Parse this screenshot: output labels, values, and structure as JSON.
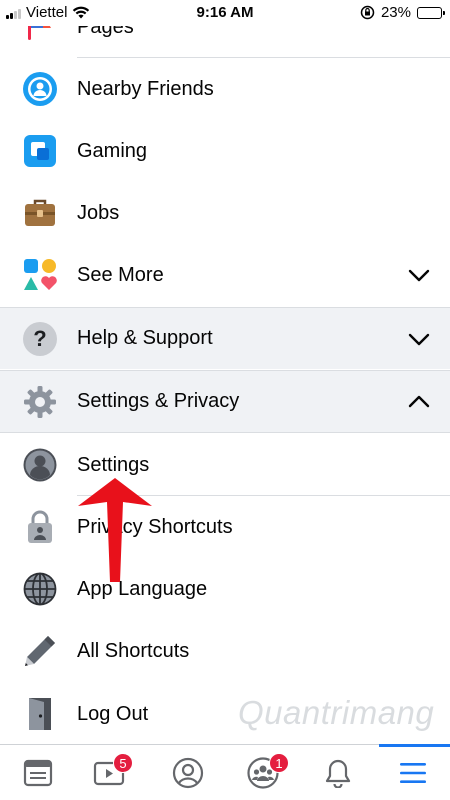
{
  "status_bar": {
    "carrier": "Viettel",
    "time": "9:16 AM",
    "battery_percent": "23%",
    "battery_level": 0.23
  },
  "menu": {
    "items": [
      {
        "label": "Pages",
        "icon": "pages-flag-icon"
      },
      {
        "label": "Nearby Friends",
        "icon": "nearby-friends-icon"
      },
      {
        "label": "Gaming",
        "icon": "gaming-icon"
      },
      {
        "label": "Jobs",
        "icon": "briefcase-icon"
      },
      {
        "label": "See More",
        "icon": "see-more-shapes-icon"
      }
    ],
    "help": {
      "label": "Help & Support",
      "icon": "question-icon"
    },
    "settings_privacy": {
      "label": "Settings & Privacy",
      "icon": "gear-icon"
    },
    "sub_items": [
      {
        "label": "Settings",
        "icon": "profile-icon"
      },
      {
        "label": "Privacy Shortcuts",
        "icon": "lock-icon"
      },
      {
        "label": "App Language",
        "icon": "globe-icon"
      },
      {
        "label": "All Shortcuts",
        "icon": "pencil-icon"
      },
      {
        "label": "Log Out",
        "icon": "door-icon"
      }
    ]
  },
  "tab_bar": {
    "tabs": [
      {
        "name": "news-feed",
        "icon": "news-feed-icon"
      },
      {
        "name": "watch",
        "icon": "watch-icon",
        "badge": "5"
      },
      {
        "name": "profile",
        "icon": "profile-icon"
      },
      {
        "name": "groups",
        "icon": "groups-icon",
        "badge": "1"
      },
      {
        "name": "notifications",
        "icon": "bell-icon"
      },
      {
        "name": "menu",
        "icon": "hamburger-icon",
        "active": true
      }
    ]
  },
  "watermark": "Quantrimang",
  "colors": {
    "accent": "#1877f2",
    "badge": "#e41e3f",
    "arrow": "#e8111b",
    "section_bg": "#f0f2f5"
  }
}
